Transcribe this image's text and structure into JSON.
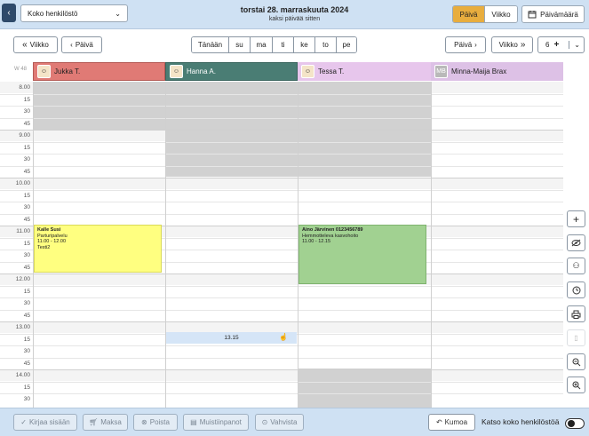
{
  "header": {
    "staff_select": "Koko henkilöstö",
    "title": "torstai 28. marraskuuta 2024",
    "subtitle": "kaksi päivää sitten",
    "view_day": "Päivä",
    "view_week": "Viikko",
    "date_button": "Päivämäärä"
  },
  "nav": {
    "prev_week": "Viikko",
    "prev_day": "Päivä",
    "today": "Tänään",
    "days": [
      "su",
      "ma",
      "ti",
      "ke",
      "to",
      "pe"
    ],
    "next_day": "Päivä",
    "next_week": "Viikko",
    "count_value": "6"
  },
  "calendar": {
    "week_label": "W 48",
    "columns": [
      {
        "name": "Jukka T.",
        "color": "#e07a75",
        "avatar": ""
      },
      {
        "name": "Hanna A.",
        "color": "#4a7d74",
        "avatar": ""
      },
      {
        "name": "Tessa T.",
        "color": "#e7c6ec",
        "avatar": ""
      },
      {
        "name": "Minna-Maija Brax",
        "color": "#ddc1e6",
        "avatar": "MB"
      }
    ],
    "time_labels": [
      "8.00",
      "15",
      "30",
      "45",
      "9.00",
      "15",
      "30",
      "45",
      "10.00",
      "15",
      "30",
      "45",
      "11.00",
      "15",
      "30",
      "45",
      "12.00",
      "15",
      "30",
      "45",
      "13.00",
      "15",
      "30",
      "45",
      "14.00",
      "15",
      "30"
    ],
    "appointments": [
      {
        "name": "Kalle Susi",
        "service": "Parturipalvelu",
        "time": "11.00 - 12.00",
        "note": "Testi2",
        "color": "#ffff80"
      },
      {
        "name": "Aino Järvinen 0123456789",
        "service": "Hemmotteleva kasvohoito",
        "time": "11.00 - 12.15",
        "note": "",
        "color": "#a1d191"
      }
    ],
    "hover_slot": "13.15"
  },
  "footer": {
    "checkin": "Kirjaa sisään",
    "pay": "Maksa",
    "remove": "Poista",
    "notes": "Muistiinpanot",
    "confirm": "Vahvista",
    "undo": "Kumoa",
    "show_all_label": "Katso koko henkilöstöä"
  },
  "colors": {
    "header_bg": "#cfe1f3",
    "accent": "#e8ad3e",
    "closed": "#d1d1d1",
    "slot_hover": "#d5e5f7"
  }
}
